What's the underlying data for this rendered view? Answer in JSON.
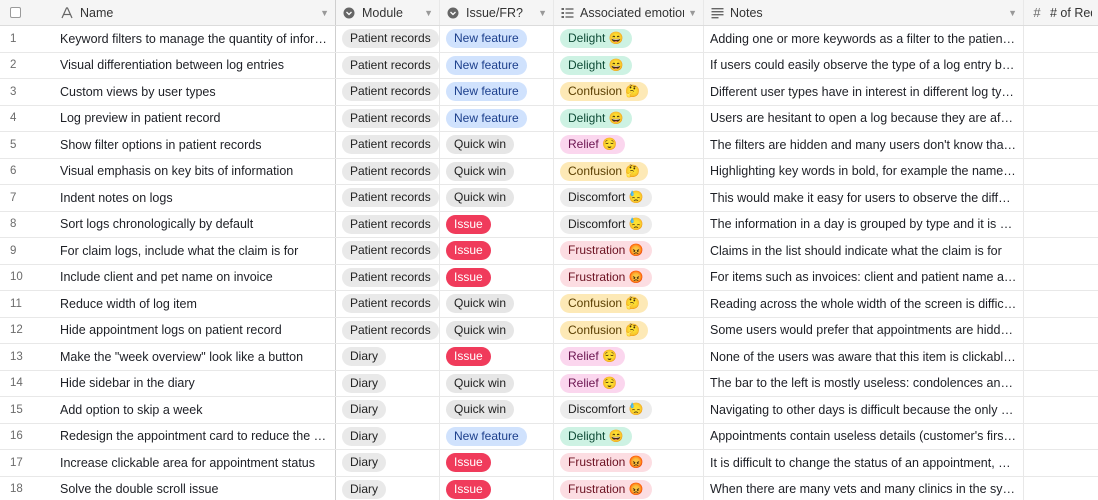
{
  "header": {
    "name": "Name",
    "module": "Module",
    "issue": "Issue/FR?",
    "emotions": "Associated emotions",
    "notes": "Notes",
    "requests": "# of Reque"
  },
  "rows": [
    {
      "num": "1",
      "name": "Keyword filters to manage the quantity of information in the patient file",
      "module": "Patient records",
      "issue": "New feature",
      "issue_kind": "new",
      "emotion": "Delight 😄",
      "emotion_kind": "delight",
      "notes": "Adding one or more keywords as a filter to the patient file would help"
    },
    {
      "num": "2",
      "name": "Visual differentiation between log entries",
      "module": "Patient records",
      "issue": "New feature",
      "issue_kind": "new",
      "emotion": "Delight 😄",
      "emotion_kind": "delight",
      "notes": "If users could easily observe the type of a log entry by the way it looks"
    },
    {
      "num": "3",
      "name": "Custom views by user types",
      "module": "Patient records",
      "issue": "New feature",
      "issue_kind": "new",
      "emotion": "Confusion 🤔",
      "emotion_kind": "confusion",
      "notes": "Different user types have in interest in different log types which"
    },
    {
      "num": "4",
      "name": "Log preview in patient record",
      "module": "Patient records",
      "issue": "New feature",
      "issue_kind": "new",
      "emotion": "Delight 😄",
      "emotion_kind": "delight",
      "notes": "Users are hesitant to open a log because they are afraid to lose"
    },
    {
      "num": "5",
      "name": "Show filter options in patient records",
      "module": "Patient records",
      "issue": "Quick win",
      "issue_kind": "quick",
      "emotion": "Relief 😌",
      "emotion_kind": "relief",
      "notes": "The filters are hidden and many users don't know that they exist"
    },
    {
      "num": "6",
      "name": "Visual emphasis on key bits of information",
      "module": "Patient records",
      "issue": "Quick win",
      "issue_kind": "quick",
      "emotion": "Confusion 🤔",
      "emotion_kind": "confusion",
      "notes": "Highlighting key words in bold, for example the names of a drug"
    },
    {
      "num": "7",
      "name": "Indent notes on logs",
      "module": "Patient records",
      "issue": "Quick win",
      "issue_kind": "quick",
      "emotion": "Discomfort 😓",
      "emotion_kind": "discomfort",
      "notes": "This would make it easy for users to observe the difference between"
    },
    {
      "num": "8",
      "name": "Sort logs chronologically by default",
      "module": "Patient records",
      "issue": "Issue",
      "issue_kind": "issue",
      "emotion": "Discomfort 😓",
      "emotion_kind": "discomfort",
      "notes": "The information in a day is grouped by type and it is difficult to"
    },
    {
      "num": "9",
      "name": "For claim logs, include what the claim is for",
      "module": "Patient records",
      "issue": "Issue",
      "issue_kind": "issue",
      "emotion": "Frustration 😡",
      "emotion_kind": "frustration",
      "notes": "Claims in the list should indicate what the claim is for"
    },
    {
      "num": "10",
      "name": "Include client and pet name on invoice",
      "module": "Patient records",
      "issue": "Issue",
      "issue_kind": "issue",
      "emotion": "Frustration 😡",
      "emotion_kind": "frustration",
      "notes": "For items such as invoices: client and patient name as well as"
    },
    {
      "num": "11",
      "name": "Reduce width of log item",
      "module": "Patient records",
      "issue": "Quick win",
      "issue_kind": "quick",
      "emotion": "Confusion 🤔",
      "emotion_kind": "confusion",
      "notes": "Reading across the whole width of the screen is difficult and"
    },
    {
      "num": "12",
      "name": "Hide appointment logs on patient record",
      "module": "Patient records",
      "issue": "Quick win",
      "issue_kind": "quick",
      "emotion": "Confusion 🤔",
      "emotion_kind": "confusion",
      "notes": "Some users would prefer that appointments are hidden by default"
    },
    {
      "num": "13",
      "name": "Make the \"week overview\" look like a button",
      "module": "Diary",
      "issue": "Issue",
      "issue_kind": "issue",
      "emotion": "Relief 😌",
      "emotion_kind": "relief",
      "notes": "None of the users was aware that this item is clickable because"
    },
    {
      "num": "14",
      "name": "Hide sidebar in the diary",
      "module": "Diary",
      "issue": "Quick win",
      "issue_kind": "quick",
      "emotion": "Relief 😌",
      "emotion_kind": "relief",
      "notes": "The bar to the left is mostly useless: condolences and calls are"
    },
    {
      "num": "15",
      "name": "Add option to skip a week",
      "module": "Diary",
      "issue": "Quick win",
      "issue_kind": "quick",
      "emotion": "Discomfort 😓",
      "emotion_kind": "discomfort",
      "notes": "Navigating to other days is difficult because the only way to"
    },
    {
      "num": "16",
      "name": "Redesign the appointment card to reduce the amount of information",
      "module": "Diary",
      "issue": "New feature",
      "issue_kind": "new",
      "emotion": "Delight 😄",
      "emotion_kind": "delight",
      "notes": "Appointments contain useless details (customer's first name"
    },
    {
      "num": "17",
      "name": "Increase clickable area for appointment status",
      "module": "Diary",
      "issue": "Issue",
      "issue_kind": "issue",
      "emotion": "Frustration 😡",
      "emotion_kind": "frustration",
      "notes": "It is difficult to change the status of an appointment, because"
    },
    {
      "num": "18",
      "name": "Solve the double scroll issue",
      "module": "Diary",
      "issue": "Issue",
      "issue_kind": "issue",
      "emotion": "Frustration 😡",
      "emotion_kind": "frustration",
      "notes": "When there are many vets and many clinics in the system, a"
    }
  ]
}
